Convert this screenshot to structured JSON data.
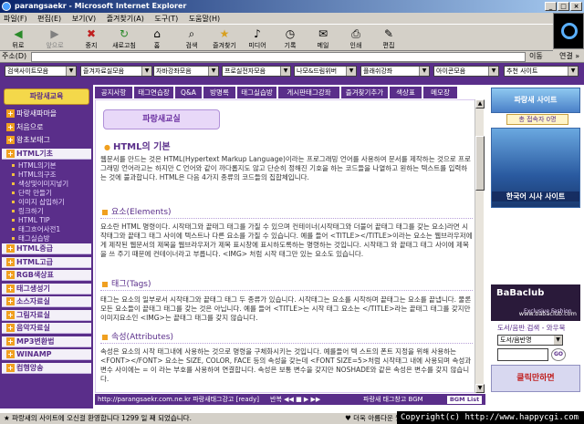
{
  "window": {
    "title": "parangsaekr - Microsoft Internet Explorer",
    "min": "_",
    "max": "□",
    "close": "×"
  },
  "menu": [
    "파일(F)",
    "편집(E)",
    "보기(V)",
    "즐겨찾기(A)",
    "도구(T)",
    "도움말(H)"
  ],
  "toolbar": {
    "back": "뒤로",
    "forward": "앞으로",
    "stop": "중지",
    "refresh": "새로고침",
    "home": "홈",
    "search": "검색",
    "favorites": "즐겨찾기",
    "media": "미디어",
    "history": "기록",
    "mail": "메일",
    "print": "인쇄",
    "edit": "편집"
  },
  "address": {
    "label": "주소(D)",
    "value": "",
    "go": "이동",
    "links": "연결 »"
  },
  "topselects": [
    "검색사이트모음",
    "즐겨자료실모음",
    "자바강좌모음",
    "프로실전자모음",
    "나모&드림위버",
    "플래쉬강좌",
    "아이콘모음",
    "추천 사이트"
  ],
  "leftnav": {
    "logo": "파랑새교육",
    "items": [
      {
        "label": "파랑새파마을",
        "type": "nav"
      },
      {
        "label": "처음으로",
        "type": "nav"
      },
      {
        "label": "왕초보태그",
        "type": "nav"
      },
      {
        "label": "HTML기초",
        "type": "bar"
      },
      {
        "label": "HTML의기본",
        "type": "sub"
      },
      {
        "label": "HTML의구조",
        "type": "sub"
      },
      {
        "label": "색상및이미지넣기",
        "type": "sub"
      },
      {
        "label": "단락 만들기",
        "type": "sub"
      },
      {
        "label": "이미지 삽입하기",
        "type": "sub"
      },
      {
        "label": "링크하기",
        "type": "sub"
      },
      {
        "label": "HTML TIP",
        "type": "sub"
      },
      {
        "label": "태그흐어사전1",
        "type": "sub"
      },
      {
        "label": "태그실습방",
        "type": "sub"
      },
      {
        "label": "HTML중급",
        "type": "bar"
      },
      {
        "label": "HTML고급",
        "type": "bar"
      },
      {
        "label": "RGB색상표",
        "type": "bar"
      },
      {
        "label": "태그생성기",
        "type": "bar"
      },
      {
        "label": "소스자료실",
        "type": "bar"
      },
      {
        "label": "그림자료실",
        "type": "bar"
      },
      {
        "label": "음악자료실",
        "type": "bar"
      },
      {
        "label": "MP3변환법",
        "type": "bar"
      },
      {
        "label": "WINAMP",
        "type": "bar"
      },
      {
        "label": "컴행앙송",
        "type": "bar"
      }
    ]
  },
  "tabs": [
    "공지사항",
    "태그연습장",
    "Q&A",
    "방명록",
    "태그실습방",
    "게시판태그강좌",
    "즐겨찾기추가",
    "색상표",
    "메모장"
  ],
  "content": {
    "banner": "파랑새교실",
    "title": "HTML의 기본",
    "intro": "웹문서를 만드는 것은 HTML(Hypertext Markup Language)이라는 프로그래밍 언어를 사용하여 문서를 제작하는 것으로 프로그래밍 언어라고는 하지만 C 언어와 같이 까다롭지도 않고 단순히 정해진 기호을 하는 코드들을 나열하고 원하는 텍스트를 입력하는 것에 불과합니다. HTML은 다음 4가지 종류의 코드들의 집합체입니다.",
    "sections": [
      {
        "heading": "요소(Elements)",
        "text": "요소란 HTML 명령이다. 시작태그와 끝태그 태그를 가질 수 있으며 컨테이너(시작태그와 더불어 끝태그 태그를 갖는 요소)라면 시작태그와 끝태그 태그 사이에 텍스트나 다른 요소를 가질 수 있습니다. 예를 들어 <TITLE></TITLE>이라는 요소는 웹브라우저에게 제작된 웹문서의 제목을 웹브라우저가 제목 표시창에 표시하도록하는 명령하는 것입니다. 시작태그 와 끝태그 태그 사이에 제목을 쓰 주기 때문에 컨테이너라고 부릅니다. <IMG> 처럼 시작 태그만 있는 요소도 있습니다."
      },
      {
        "heading": "태그(Tags)",
        "text": "태그는 요소의 일부로서 시작태그와 끝태그 태그 두 종류가 있습니다. 시작태그는 요소를 시작하며 끝태그는 요소를 끝냅니다. 물론 모든 요소들이 끝태그 태그를 갖는 것은 아닙니다. 예를 들어 <TITLE>는 시작 태그 요소는 </TITLE>라는 끝태그 태그를 갖지만 이미지요소인 <IMG>는 끝태그 태그를 갖지 않습니다."
      },
      {
        "heading": "속성(Attributes)",
        "text": "속성은 요소의 시작 태그내에 사용하는 것으로 명령을 구체화시키는 것입니다. 예를들어 텍 스트의 폰트 지정을 위해 사용하는 <FONT></FONT> 요소는 SIZE, COLOR, FACE 등의 속성을 갖는데 <FONT SIZE=5>처럼 시작태그 내에 사용되며 속성과 변수 사이에는 = 이 라는 부호를 사용하여 연결합니다. 속성은 보통 변수을 갖지만 NOSHADE와 같은 속성은 변수를 갖지 않습니다."
      }
    ]
  },
  "bgm": {
    "url": "http://parangsaekr.com.ne.kr 파랑새태그강고 [ready]",
    "controls": "반복 ◀◀ ■ ▶ ▶▶",
    "title": "파랑새 태그창고 BGM",
    "list": "BGM List"
  },
  "right": {
    "visit": "파랑새 사이트",
    "count": "총 접속자 0명",
    "aqua": "한국어 시사 사이트",
    "ad": "BaBaclub",
    "ad_small": "Exclusive Fashion Style",
    "url": "www.babaclub.com",
    "search_label": "도서/음반 검색 - 와우북",
    "select": "도서/음반명",
    "go": "GO",
    "click": "클릭만하면"
  },
  "status": {
    "left": "★ 파랑새의 사이트에 오신걸 환영합니다 1299 일 째 되었습니다.",
    "right": "♥ 더욱 아름다운 웹을 만들 준비가 되었습니다.",
    "copyright": "Copyright(c) http://www.happycgi.com"
  }
}
